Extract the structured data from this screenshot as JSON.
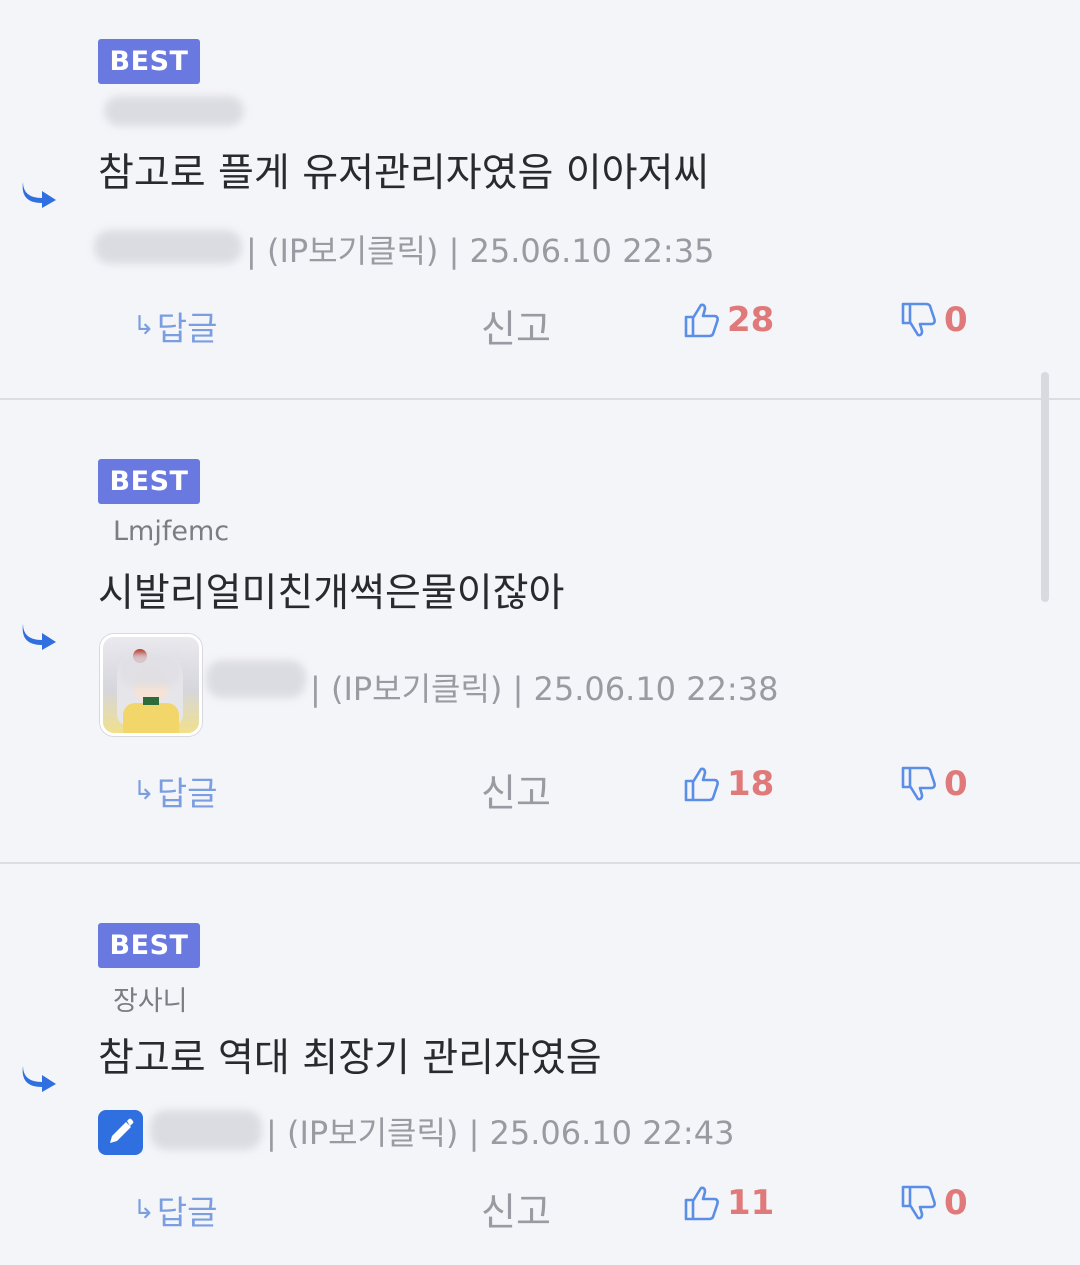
{
  "comments": [
    {
      "badge": "BEST",
      "parent_author": "",
      "text": "참고로 플게 유저관리자였음 이아저씨",
      "meta": "| (IP보기클릭) | 25.06.10 22:35",
      "reply_label": "답글",
      "report_label": "신고",
      "likes": "28",
      "dislikes": "0"
    },
    {
      "badge": "BEST",
      "parent_author": "Lmjfemc",
      "text": "시발리얼미친개썩은물이잖아",
      "meta": "| (IP보기클릭) | 25.06.10 22:38",
      "reply_label": "답글",
      "report_label": "신고",
      "likes": "18",
      "dislikes": "0"
    },
    {
      "badge": "BEST",
      "parent_author": "장사니",
      "text": "참고로 역대 최장기 관리자였음",
      "meta": "| (IP보기클릭) | 25.06.10 22:43",
      "reply_label": "답글",
      "report_label": "신고",
      "likes": "11",
      "dislikes": "0"
    }
  ],
  "icons": {
    "reply_arrow": "reply-arrow-icon",
    "thumbs_up": "thumbs-up-icon",
    "thumbs_down": "thumbs-down-icon",
    "edit": "pencil-icon"
  },
  "colors": {
    "badge": "#6a79e0",
    "accent_blue": "#2f6fe0",
    "count": "#e07a7a",
    "background": "#f4f5f8"
  }
}
